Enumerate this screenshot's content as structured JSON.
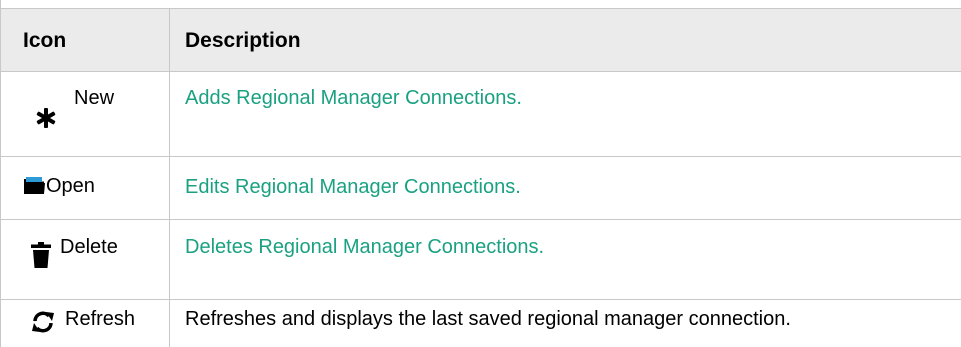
{
  "table": {
    "headers": {
      "icon": "Icon",
      "description": "Description"
    },
    "rows": [
      {
        "icon_name": "asterisk-icon",
        "label": "New",
        "description": "Adds Regional Manager Connections.",
        "is_link": true
      },
      {
        "icon_name": "folder-icon",
        "label": "Open",
        "description": "Edits Regional Manager Connections.",
        "is_link": true
      },
      {
        "icon_name": "trash-icon",
        "label": "Delete",
        "description": "Deletes Regional Manager Connections.",
        "is_link": true
      },
      {
        "icon_name": "refresh-icon",
        "label": "Refresh",
        "description": "Refreshes and displays the last saved regional manager connection.",
        "is_link": false
      }
    ]
  },
  "colors": {
    "link": "#1aa182",
    "header_bg": "#ebebeb",
    "border": "#c8c8c8",
    "text": "#000000"
  }
}
